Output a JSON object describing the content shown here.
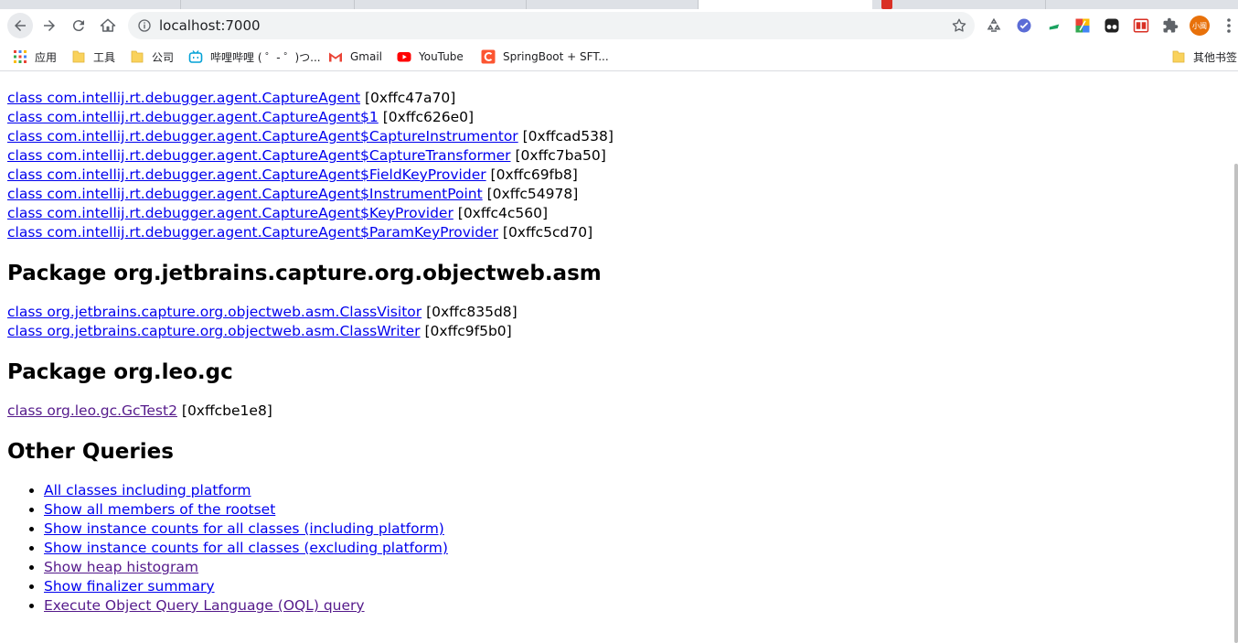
{
  "browser": {
    "url": "localhost:7000",
    "profile_label": "小闽",
    "bookmarks": [
      {
        "label": "应用",
        "icon": "apps-grid-icon"
      },
      {
        "label": "工具",
        "icon": "folder-icon"
      },
      {
        "label": "公司",
        "icon": "folder-icon"
      },
      {
        "label": "哔哩哔哩 ( ゜- ゜)つ...",
        "icon": "bilibili-icon"
      },
      {
        "label": "Gmail",
        "icon": "gmail-icon"
      },
      {
        "label": "YouTube",
        "icon": "youtube-icon"
      },
      {
        "label": "SpringBoot + SFT...",
        "icon": "bookmark-c-icon"
      }
    ],
    "other_bookmarks": "其他书签"
  },
  "page": {
    "classes_top": [
      {
        "name": "class com.intellij.rt.debugger.agent.CaptureAgent",
        "addr": "[0xffc47a70]"
      },
      {
        "name": "class com.intellij.rt.debugger.agent.CaptureAgent$1",
        "addr": "[0xffc626e0]"
      },
      {
        "name": "class com.intellij.rt.debugger.agent.CaptureAgent$CaptureInstrumentor",
        "addr": "[0xffcad538]"
      },
      {
        "name": "class com.intellij.rt.debugger.agent.CaptureAgent$CaptureTransformer",
        "addr": "[0xffc7ba50]"
      },
      {
        "name": "class com.intellij.rt.debugger.agent.CaptureAgent$FieldKeyProvider",
        "addr": "[0xffc69fb8]"
      },
      {
        "name": "class com.intellij.rt.debugger.agent.CaptureAgent$InstrumentPoint",
        "addr": "[0xffc54978]"
      },
      {
        "name": "class com.intellij.rt.debugger.agent.CaptureAgent$KeyProvider",
        "addr": "[0xffc4c560]"
      },
      {
        "name": "class com.intellij.rt.debugger.agent.CaptureAgent$ParamKeyProvider",
        "addr": "[0xffc5cd70]"
      }
    ],
    "package_asm": {
      "heading": "Package org.jetbrains.capture.org.objectweb.asm",
      "classes": [
        {
          "name": "class org.jetbrains.capture.org.objectweb.asm.ClassVisitor",
          "addr": "[0xffc835d8]"
        },
        {
          "name": "class org.jetbrains.capture.org.objectweb.asm.ClassWriter",
          "addr": "[0xffc9f5b0]"
        }
      ]
    },
    "package_gc": {
      "heading": "Package org.leo.gc",
      "classes": [
        {
          "name": "class org.leo.gc.GcTest2",
          "addr": "[0xffcbe1e8]"
        }
      ]
    },
    "other_queries": {
      "heading": "Other Queries",
      "items": [
        "All classes including platform",
        "Show all members of the rootset",
        "Show instance counts for all classes (including platform)",
        "Show instance counts for all classes (excluding platform)",
        "Show heap histogram",
        "Show finalizer summary",
        "Execute Object Query Language (OQL) query"
      ]
    }
  }
}
